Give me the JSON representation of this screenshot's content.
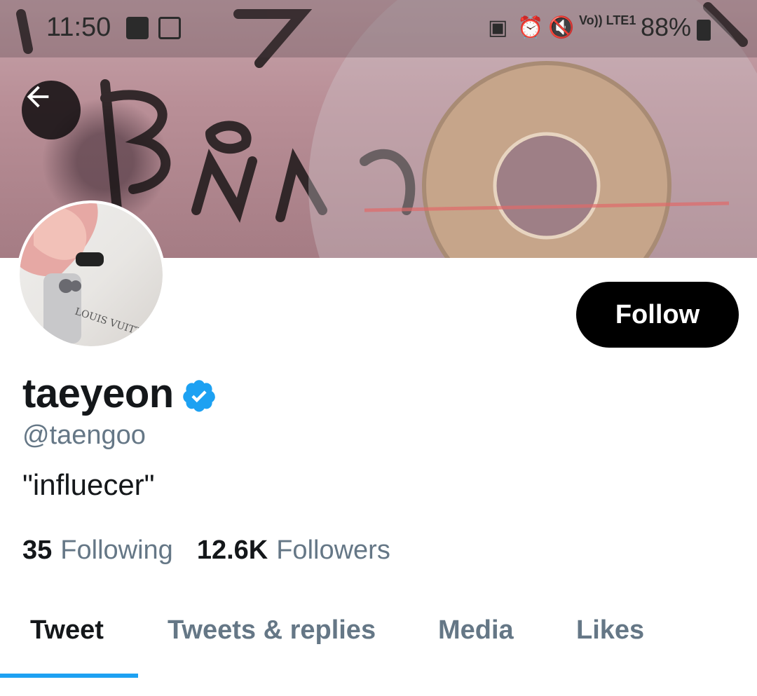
{
  "status_bar": {
    "time": "11:50",
    "signal": "Vo)) LTE1",
    "battery": "88%"
  },
  "header": {
    "back_icon": "arrow-left-icon"
  },
  "profile": {
    "display_name": "taeyeon",
    "verified": true,
    "handle": "@taengoo",
    "bio": "\"influecer\"",
    "follow_label": "Follow",
    "following_count": "35",
    "following_label": "Following",
    "followers_count": "12.6K",
    "followers_label": "Followers"
  },
  "tabs": [
    {
      "label": "Tweet",
      "active": true
    },
    {
      "label": "Tweets & replies",
      "active": false
    },
    {
      "label": "Media",
      "active": false
    },
    {
      "label": "Likes",
      "active": false
    }
  ],
  "colors": {
    "accent": "#1da1f2",
    "secondary_text": "#657786",
    "follow_button": "#000000"
  }
}
